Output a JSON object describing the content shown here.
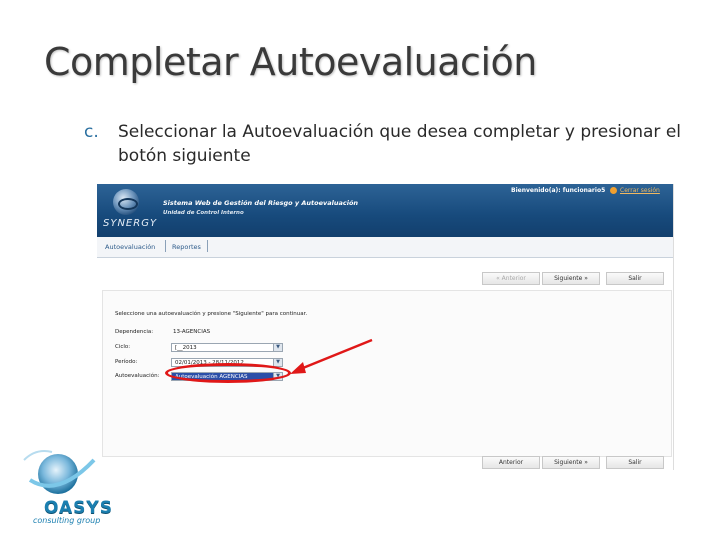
{
  "slide": {
    "title": "Completar Autoevaluación",
    "bullet_marker": "c.",
    "bullet_text": "Seleccionar la Autoevaluación que desea completar y presionar el botón siguiente"
  },
  "app": {
    "logo_text": "SYNERGY",
    "system_title": "Sistema Web de Gestión del Riesgo y Autoevaluación",
    "system_subtitle": "Unidad de Control Interno",
    "welcome": "Bienvenido(a): funcionario5",
    "logout": "Cerrar sesión",
    "menu": [
      "Autoevaluación",
      "Reportes"
    ],
    "toolbar_top": {
      "prev": "« Anterior",
      "next": "Siguiente »",
      "exit": "Salir"
    },
    "toolbar_bottom": {
      "prev": "Anterior",
      "next": "Siguiente »",
      "exit": "Salir"
    },
    "form": {
      "instruction": "Seleccione una autoevaluación y presione \"Siguiente\" para continuar.",
      "dependencia_label": "Dependencia:",
      "dependencia_value": "13-AGENCIAS",
      "ciclo_label": "Ciclo:",
      "ciclo_value": "[__2013",
      "periodo_label": "Período:",
      "periodo_value": "02/01/2013 - 28/11/2012",
      "autoeval_label": "Autoevaluación:",
      "autoeval_value": "Autoevaluación AGENCIAS"
    }
  },
  "branding": {
    "name": "OASYS",
    "tagline": "consulting group"
  },
  "colors": {
    "banner": "#174a7c",
    "highlight_circle": "#e01818",
    "selection": "#2b4fa8",
    "oasys_blue": "#1b7fb0"
  }
}
